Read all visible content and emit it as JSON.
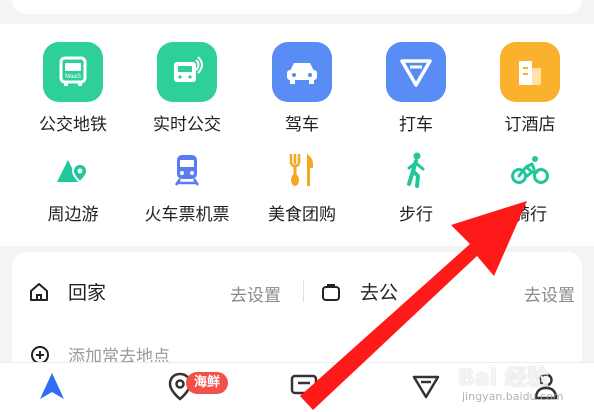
{
  "services": [
    {
      "label": "公交地铁",
      "icon": "bus-icon",
      "color": "#2ecf9b"
    },
    {
      "label": "实时公交",
      "icon": "realtime-bus-icon",
      "color": "#2ecf9b"
    },
    {
      "label": "驾车",
      "icon": "car-icon",
      "color": "#5a8cf6"
    },
    {
      "label": "打车",
      "icon": "taxi-icon",
      "color": "#5a8cf6"
    },
    {
      "label": "订酒店",
      "icon": "hotel-icon",
      "color": "#fbb12e"
    },
    {
      "label": "周边游",
      "icon": "mountain-pin-icon",
      "color": "#21c79a"
    },
    {
      "label": "火车票机票",
      "icon": "train-icon",
      "color": "#5a7cf0"
    },
    {
      "label": "美食团购",
      "icon": "food-icon",
      "color": "#f5a623"
    },
    {
      "label": "步行",
      "icon": "walk-icon",
      "color": "#21c79a"
    },
    {
      "label": "骑行",
      "icon": "bike-icon",
      "color": "#21c79a"
    }
  ],
  "quick": {
    "home_label": "回家",
    "home_action": "去设置",
    "work_label": "去公",
    "work_action": "去设置",
    "add_label": "添加常去地点"
  },
  "nav": {
    "badge": "海鲜"
  },
  "watermark": {
    "text": "Bai 经验",
    "sub": "jingyan.baidu.com"
  },
  "colors": {
    "arrow": "#ff1a1a",
    "nav_active": "#2f6df5"
  }
}
